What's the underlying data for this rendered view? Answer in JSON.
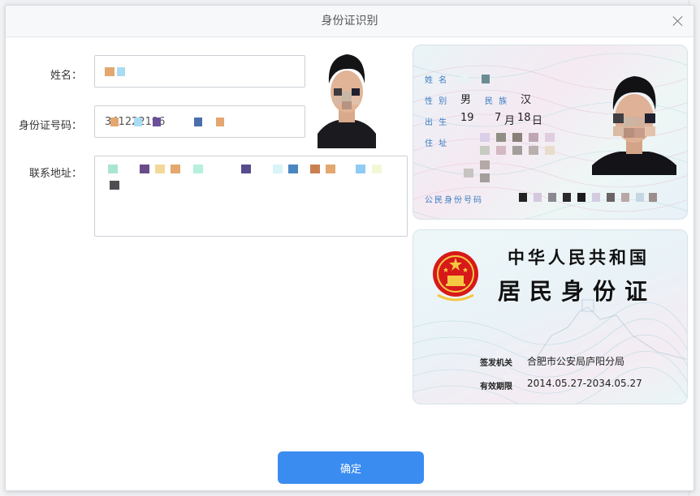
{
  "dialog": {
    "title": "身份证识别",
    "confirm_label": "确定"
  },
  "form": {
    "name_label": "姓名：",
    "id_number_label": "身份证号码：",
    "id_number_partial": "341222196",
    "address_label": "联系地址："
  },
  "id_front": {
    "name_field": "姓 名",
    "sex_field": "性 别",
    "sex_value": "男",
    "ethnicity_field": "民 族",
    "ethnicity_value": "汉",
    "birth_field": "出 生",
    "birth_year_partial": "19",
    "birth_month": "7",
    "birth_month_unit": "月",
    "birth_day": "18",
    "birth_day_unit": "日",
    "address_field": "住 址",
    "id_number_field": "公民身份号码"
  },
  "id_back": {
    "country": "中华人民共和国",
    "card_title": "居民身份证",
    "issuer_label": "签发机关",
    "issuer_value": "合肥市公安局庐阳分局",
    "validity_label": "有效期限",
    "validity_value": "2014.05.27-2034.05.27"
  },
  "colors": {
    "primary_button": "#3b8cf0",
    "label_blue": "#3a7bc0",
    "emblem_red": "#d7191a"
  }
}
